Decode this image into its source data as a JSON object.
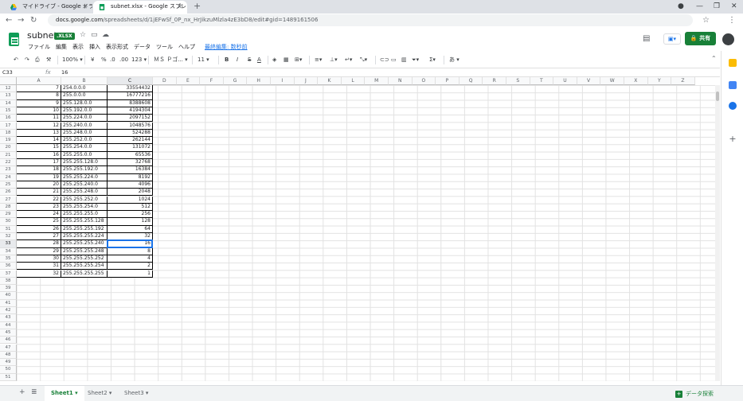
{
  "browser": {
    "tabs": [
      {
        "title": "マイドライブ - Google ドライブ",
        "active": false
      },
      {
        "title": "subnet.xlsx - Google スプレッドシー",
        "active": true
      }
    ],
    "new_tab": "+",
    "url_host": "docs.google.com",
    "url_path": "/spreadsheets/d/1jEFwSf_0P_nx_HrJikzuMlzla4zE3bD8/edit#gid=1489161506",
    "window_controls": [
      "—",
      "❐",
      "✕"
    ]
  },
  "doc": {
    "title": "subnet",
    "badge": ".XLSX",
    "share_label": "共有",
    "menus": [
      "ファイル",
      "編集",
      "表示",
      "挿入",
      "表示形式",
      "データ",
      "ツール",
      "ヘルプ"
    ],
    "last_edit": "最終編集: 数秒前"
  },
  "toolbar": {
    "zoom": "100%",
    "currency": "¥",
    "percent": "%",
    "decimal_less": ".0",
    "decimal_more": ".00",
    "number_format": "123",
    "font": "ＭＳ Ｐゴ...",
    "font_size": "11",
    "bold": "B",
    "italic": "I",
    "strike": "S",
    "text_color": "A",
    "input_tools": "あ"
  },
  "formula_bar": {
    "name_box": "C33",
    "fx": "fx",
    "value": "16"
  },
  "columns": [
    "A",
    "B",
    "C",
    "D",
    "E",
    "F",
    "G",
    "H",
    "I",
    "J",
    "K",
    "L",
    "M",
    "N",
    "O",
    "P",
    "Q",
    "R",
    "S",
    "T",
    "U",
    "V",
    "W",
    "X",
    "Y",
    "Z"
  ],
  "rows": [
    {
      "n": "12",
      "a": "7",
      "b": "254.0.0.0",
      "c": "33554432"
    },
    {
      "n": "13",
      "a": "8",
      "b": "255.0.0.0",
      "c": "16777216"
    },
    {
      "n": "14",
      "a": "9",
      "b": "255.128.0.0",
      "c": "8388608"
    },
    {
      "n": "15",
      "a": "10",
      "b": "255.192.0.0",
      "c": "4194304"
    },
    {
      "n": "16",
      "a": "11",
      "b": "255.224.0.0",
      "c": "2097152"
    },
    {
      "n": "17",
      "a": "12",
      "b": "255.240.0.0",
      "c": "1048576"
    },
    {
      "n": "18",
      "a": "13",
      "b": "255.248.0.0",
      "c": "524288"
    },
    {
      "n": "19",
      "a": "14",
      "b": "255.252.0.0",
      "c": "262144"
    },
    {
      "n": "20",
      "a": "15",
      "b": "255.254.0.0",
      "c": "131072"
    },
    {
      "n": "21",
      "a": "16",
      "b": "255.255.0.0",
      "c": "65536"
    },
    {
      "n": "22",
      "a": "17",
      "b": "255.255.128.0",
      "c": "32768"
    },
    {
      "n": "23",
      "a": "18",
      "b": "255.255.192.0",
      "c": "16384"
    },
    {
      "n": "24",
      "a": "19",
      "b": "255.255.224.0",
      "c": "8192"
    },
    {
      "n": "25",
      "a": "20",
      "b": "255.255.240.0",
      "c": "4096"
    },
    {
      "n": "26",
      "a": "21",
      "b": "255.255.248.0",
      "c": "2048"
    },
    {
      "n": "27",
      "a": "22",
      "b": "255.255.252.0",
      "c": "1024"
    },
    {
      "n": "28",
      "a": "23",
      "b": "255.255.254.0",
      "c": "512"
    },
    {
      "n": "29",
      "a": "24",
      "b": "255.255.255.0",
      "c": "256"
    },
    {
      "n": "30",
      "a": "25",
      "b": "255.255.255.128",
      "c": "128"
    },
    {
      "n": "31",
      "a": "26",
      "b": "255.255.255.192",
      "c": "64"
    },
    {
      "n": "32",
      "a": "27",
      "b": "255.255.255.224",
      "c": "32"
    },
    {
      "n": "33",
      "a": "28",
      "b": "255.255.255.240",
      "c": "16"
    },
    {
      "n": "34",
      "a": "29",
      "b": "255.255.255.248",
      "c": "8"
    },
    {
      "n": "35",
      "a": "30",
      "b": "255.255.255.252",
      "c": "4"
    },
    {
      "n": "36",
      "a": "31",
      "b": "255.255.255.254",
      "c": "2"
    },
    {
      "n": "37",
      "a": "32",
      "b": "255.255.255.255",
      "c": "1"
    }
  ],
  "empty_rows": [
    "38",
    "39",
    "40",
    "41",
    "42",
    "43",
    "44",
    "45",
    "46",
    "47",
    "48",
    "49",
    "50",
    "51",
    "52"
  ],
  "selected": {
    "row": "33",
    "col": "C"
  },
  "sheets": [
    {
      "name": "Sheet1",
      "active": true
    },
    {
      "name": "Sheet2",
      "active": false
    },
    {
      "name": "Sheet3",
      "active": false
    }
  ],
  "explore_label": "データ探索",
  "colors": {
    "accent_green": "#188038",
    "selection_blue": "#1a73e8"
  }
}
